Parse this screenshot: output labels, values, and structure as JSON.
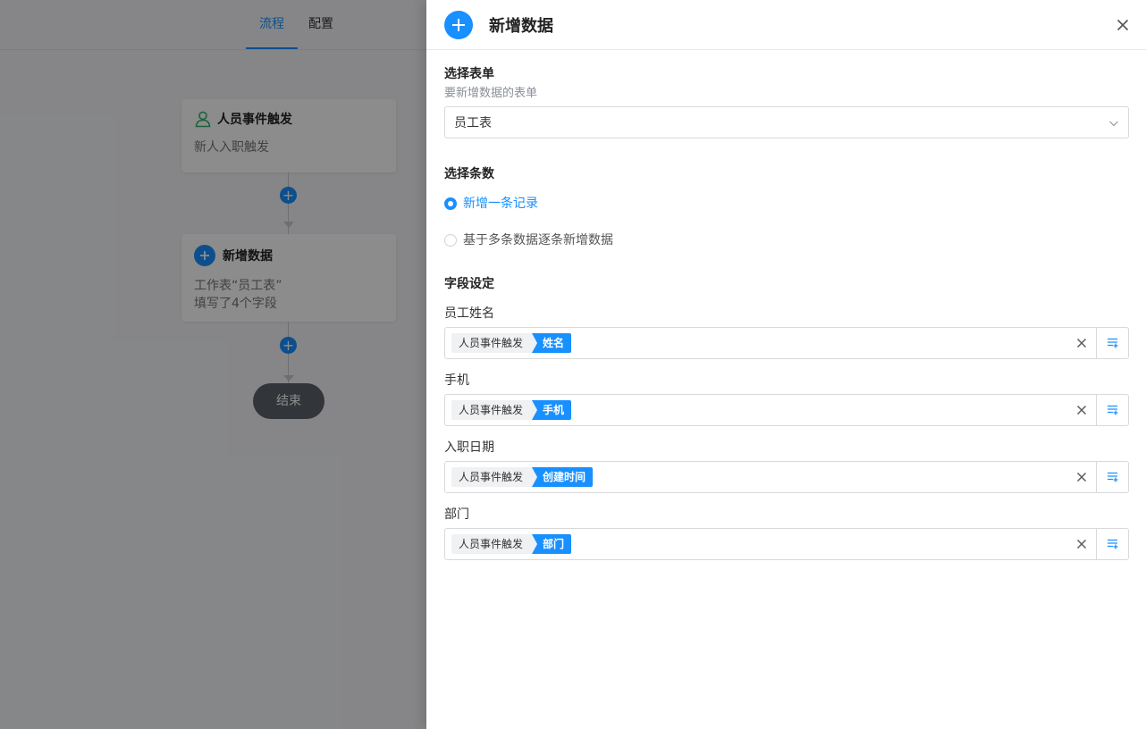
{
  "canvas": {
    "tabs": [
      {
        "label": "流程",
        "active": true
      },
      {
        "label": "配置",
        "active": false
      }
    ],
    "trigger_node": {
      "title": "人员事件触发",
      "desc": "新人入职触发",
      "icon": "user-icon"
    },
    "action_node": {
      "title": "新增数据",
      "desc_line1": "工作表“员工表”",
      "desc_line2": "填写了4个字段",
      "icon": "plus-icon"
    },
    "add_step_glyph": "+",
    "end_label": "结束"
  },
  "drawer": {
    "title": "新增数据",
    "header_icon": "plus-icon",
    "close_icon": "close-icon",
    "form_section": {
      "title": "选择表单",
      "subtitle": "要新增数据的表单",
      "selected": "员工表"
    },
    "count_section": {
      "title": "选择条数",
      "options": [
        {
          "label": "新增一条记录",
          "checked": true
        },
        {
          "label": "基于多条数据逐条新增数据",
          "checked": false
        }
      ]
    },
    "fields_section": {
      "title": "字段设定",
      "fields": [
        {
          "label": "员工姓名",
          "source": "人员事件触发",
          "value": "姓名"
        },
        {
          "label": "手机",
          "source": "人员事件触发",
          "value": "手机"
        },
        {
          "label": "入职日期",
          "source": "人员事件触发",
          "value": "创建时间"
        },
        {
          "label": "部门",
          "source": "人员事件触发",
          "value": "部门"
        }
      ]
    }
  },
  "colors": {
    "accent": "#1890ff",
    "end_node": "#5b6168",
    "mask": "rgba(0,0,0,0.45)"
  }
}
